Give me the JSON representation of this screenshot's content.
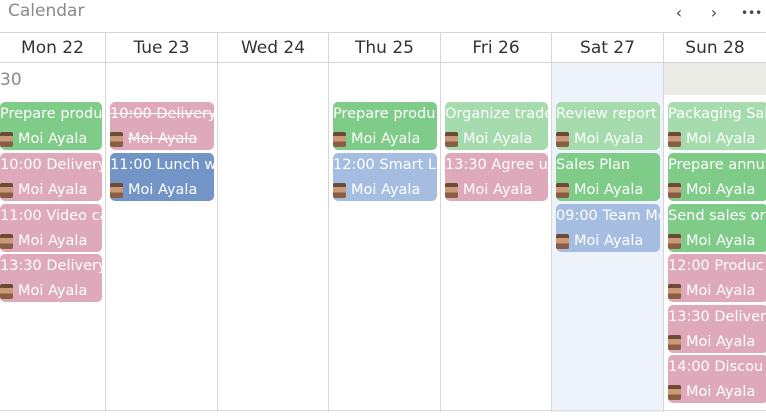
{
  "app": {
    "title": "Calendar"
  },
  "nav": {
    "prev": "‹",
    "next": "›",
    "more": "•••"
  },
  "month_label": "30",
  "days": [
    {
      "label": "Mon 22",
      "events": [
        {
          "time": "",
          "title": "Prepare produ",
          "person": "Moi Ayala",
          "color": "green"
        },
        {
          "time": "10:00",
          "title": "Delivery",
          "person": "Moi Ayala",
          "color": "pink"
        },
        {
          "time": "11:00",
          "title": "Video ca",
          "person": "Moi Ayala",
          "color": "pink"
        },
        {
          "time": "13:30",
          "title": "Delivery",
          "person": "Moi Ayala",
          "color": "pink"
        }
      ]
    },
    {
      "label": "Tue 23",
      "events": [
        {
          "time": "10:00",
          "title": "Delivery",
          "person": "Moi Ayala",
          "color": "pink",
          "struck": true
        },
        {
          "time": "11:00",
          "title": "Lunch w",
          "person": "Moi Ayala",
          "color": "blue"
        }
      ]
    },
    {
      "label": "Wed 24",
      "events": []
    },
    {
      "label": "Thu 25",
      "events": [
        {
          "time": "",
          "title": "Prepare produ",
          "person": "Moi Ayala",
          "color": "green"
        },
        {
          "time": "12:00",
          "title": "Smart La",
          "person": "Moi Ayala",
          "color": "lblue"
        }
      ]
    },
    {
      "label": "Fri 26",
      "events": [
        {
          "time": "",
          "title": "Organize trade",
          "person": "Moi Ayala",
          "color": "lgreen"
        },
        {
          "time": "13:30",
          "title": "Agree up",
          "person": "Moi Ayala",
          "color": "pink"
        }
      ]
    },
    {
      "label": "Sat 27",
      "events": [
        {
          "time": "",
          "title": "Review report",
          "person": "Moi Ayala",
          "color": "lgreen"
        },
        {
          "time": "",
          "title": "Sales Plan",
          "person": "Moi Ayala",
          "color": "green"
        },
        {
          "time": "09:00",
          "title": "Team Me",
          "person": "Moi Ayala",
          "color": "lblue"
        }
      ]
    },
    {
      "label": "Sun 28",
      "events": [
        {
          "time": "",
          "title": "Packaging Sal",
          "person": "Moi Ayala",
          "color": "lgreen"
        },
        {
          "time": "",
          "title": "Prepare annu",
          "person": "Moi Ayala",
          "color": "green"
        },
        {
          "time": "",
          "title": "Send sales ord",
          "person": "Moi Ayala",
          "color": "green"
        },
        {
          "time": "12:00",
          "title": "Produc",
          "person": "Moi Ayala",
          "color": "pink"
        },
        {
          "time": "13:30",
          "title": "Deliver",
          "person": "Moi Ayala",
          "color": "pink"
        },
        {
          "time": "14:00",
          "title": "Discou",
          "person": "Moi Ayala",
          "color": "pink"
        }
      ]
    }
  ]
}
